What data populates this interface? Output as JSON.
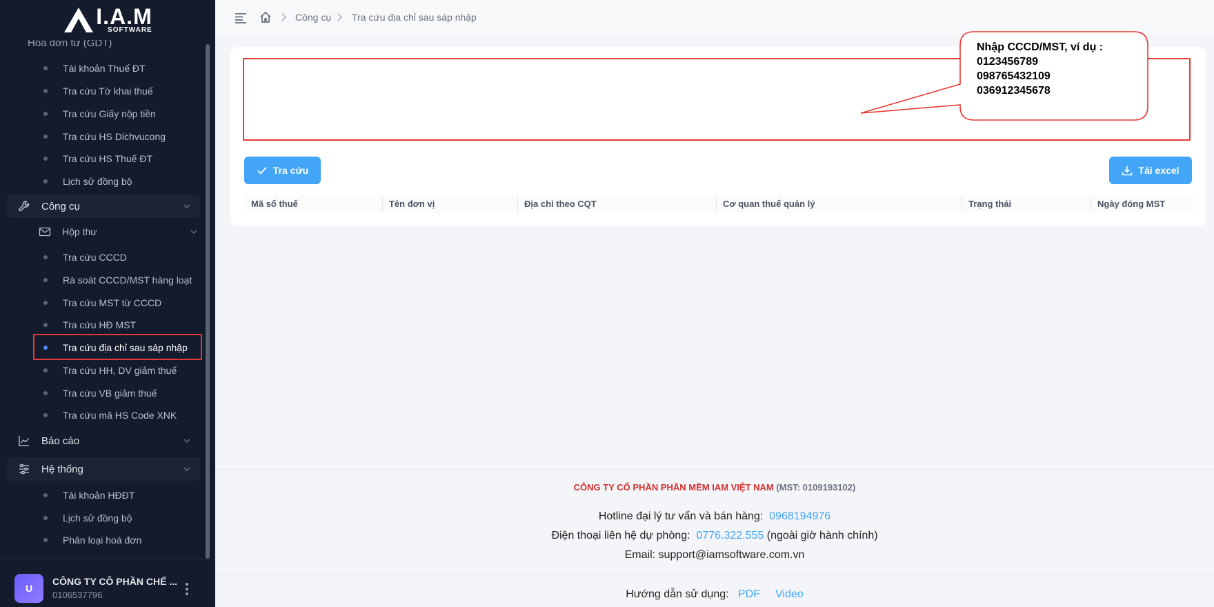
{
  "app": {
    "logo_main": "I.A.M",
    "logo_sub": "SOFTWARE"
  },
  "sidebar": {
    "clipped_top": "Hóa đơn từ (GDT)",
    "top_items": [
      {
        "label": "Tài khoản Thuế ĐT"
      },
      {
        "label": "Tra cứu Tờ khai thuế"
      },
      {
        "label": "Tra cứu Giấy nộp tiền"
      },
      {
        "label": "Tra cứu HS Dichvucong"
      },
      {
        "label": "Tra cứu HS Thuế ĐT"
      },
      {
        "label": "Lịch sử đồng bộ"
      }
    ],
    "group_tools": "Công cụ",
    "subgroup_mail": "Hộp thư",
    "tools_items": [
      {
        "label": "Tra cứu CCCD"
      },
      {
        "label": "Rà soát CCCD/MST hàng loạt"
      },
      {
        "label": "Tra cứu MST từ CCCD"
      },
      {
        "label": "Tra cứu HĐ MST"
      },
      {
        "label": "Tra cứu địa chỉ sau sáp nhập"
      },
      {
        "label": "Tra cứu HH, DV giảm thuế"
      },
      {
        "label": "Tra cứu VB giảm thuế"
      },
      {
        "label": "Tra cứu mã HS Code XNK"
      }
    ],
    "group_reports": "Báo cáo",
    "group_system": "Hệ thống",
    "system_items": [
      {
        "label": "Tài khoản HĐĐT"
      },
      {
        "label": "Lịch sử đồng bộ"
      },
      {
        "label": "Phân loại hoá đơn"
      }
    ],
    "user": {
      "avatar": "U",
      "name": "CÔNG TY CÔ PHẦN CHẾ ...",
      "mst": "0106537796"
    }
  },
  "breadcrumb": {
    "level1": "Công cụ",
    "level2": "Tra cứu địa chỉ sau sáp nhập"
  },
  "form": {
    "search_button": "Tra cứu",
    "excel_button": "Tải excel",
    "callout_lines": [
      "Nhập CCCD/MST, ví dụ :",
      "0123456789",
      "098765432109",
      "036912345678"
    ]
  },
  "table": {
    "columns": [
      "Mã số thuế",
      "Tên đơn vị",
      "Địa chỉ theo CQT",
      "Cơ quan thuế quản lý",
      "Trạng thái",
      "Ngày đóng MST"
    ]
  },
  "footer": {
    "company": "CÔNG TY CỔ PHẦN PHẦN MỀM IAM VIỆT NAM",
    "company_mst": "(MST: 0109193102)",
    "hotline_label": "Hotline đại lý tư vấn và bán hàng:",
    "hotline": "0968194976",
    "backup_label": "Điện thoại liên hệ dự phòng:",
    "backup_phone": "0776.322.555",
    "backup_note": "(ngoài giờ hành chính)",
    "email": "Email: support@iamsoftware.com.vn",
    "guide_label": "Hướng dẫn sử dụng:",
    "guide_pdf": "PDF",
    "guide_video": "Video"
  },
  "colors": {
    "accent": "#42a5f5",
    "sidebar_bg": "#141b2d",
    "highlight": "#e53935",
    "company_red": "#d32f2f"
  }
}
